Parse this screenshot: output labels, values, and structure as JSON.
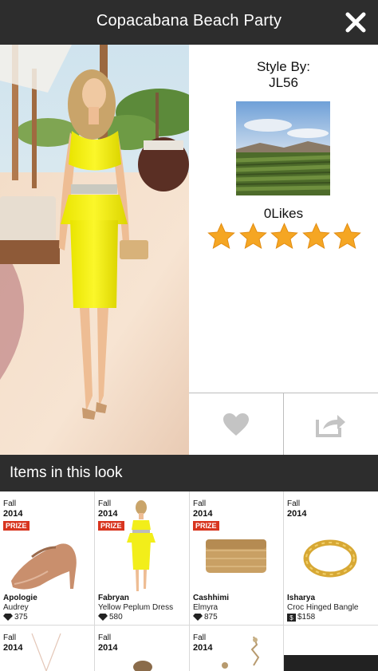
{
  "header": {
    "title": "Copacabana Beach Party",
    "close_icon": "close-icon"
  },
  "look": {
    "style_by_label": "Style By:",
    "stylist": "JL56",
    "likes_text": "0Likes",
    "rating": 5,
    "max_rating": 5,
    "star_color": "#f5a623",
    "actions": {
      "like_icon": "heart-icon",
      "share_icon": "share-icon"
    }
  },
  "items_header": {
    "title": "Items in this look"
  },
  "items": [
    {
      "season": "Fall",
      "year": "2014",
      "prize": "PRIZE",
      "brand": "Apologie",
      "name": "Audrey",
      "price": "375",
      "currency": "diamond"
    },
    {
      "season": "Fall",
      "year": "2014",
      "prize": "PRIZE",
      "brand": "Fabryan",
      "name": "Yellow Peplum Dress",
      "price": "580",
      "currency": "diamond"
    },
    {
      "season": "Fall",
      "year": "2014",
      "prize": "PRIZE",
      "brand": "Cashhimi",
      "name": "Elmyra",
      "price": "875",
      "currency": "diamond"
    },
    {
      "season": "Fall",
      "year": "2014",
      "prize": "",
      "brand": "Isharya",
      "name": "Croc Hinged Bangle",
      "price": "$158",
      "currency": "cash"
    },
    {
      "season": "Fall",
      "year": "2014"
    },
    {
      "season": "Fall",
      "year": "2014"
    },
    {
      "season": "Fall",
      "year": "2014"
    }
  ]
}
